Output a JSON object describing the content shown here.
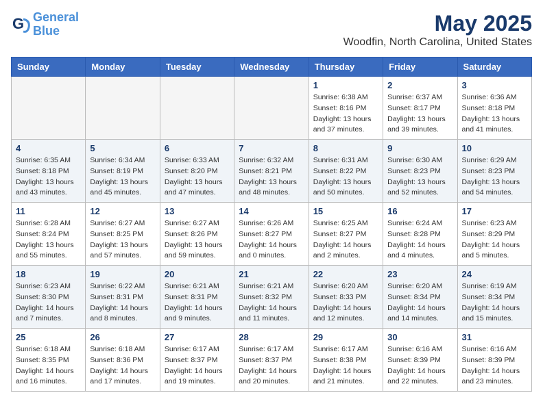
{
  "header": {
    "logo_line1": "General",
    "logo_line2": "Blue",
    "month": "May 2025",
    "location": "Woodfin, North Carolina, United States"
  },
  "days_of_week": [
    "Sunday",
    "Monday",
    "Tuesday",
    "Wednesday",
    "Thursday",
    "Friday",
    "Saturday"
  ],
  "weeks": [
    [
      {
        "num": "",
        "info": ""
      },
      {
        "num": "",
        "info": ""
      },
      {
        "num": "",
        "info": ""
      },
      {
        "num": "",
        "info": ""
      },
      {
        "num": "1",
        "info": "Sunrise: 6:38 AM\nSunset: 8:16 PM\nDaylight: 13 hours\nand 37 minutes."
      },
      {
        "num": "2",
        "info": "Sunrise: 6:37 AM\nSunset: 8:17 PM\nDaylight: 13 hours\nand 39 minutes."
      },
      {
        "num": "3",
        "info": "Sunrise: 6:36 AM\nSunset: 8:18 PM\nDaylight: 13 hours\nand 41 minutes."
      }
    ],
    [
      {
        "num": "4",
        "info": "Sunrise: 6:35 AM\nSunset: 8:18 PM\nDaylight: 13 hours\nand 43 minutes."
      },
      {
        "num": "5",
        "info": "Sunrise: 6:34 AM\nSunset: 8:19 PM\nDaylight: 13 hours\nand 45 minutes."
      },
      {
        "num": "6",
        "info": "Sunrise: 6:33 AM\nSunset: 8:20 PM\nDaylight: 13 hours\nand 47 minutes."
      },
      {
        "num": "7",
        "info": "Sunrise: 6:32 AM\nSunset: 8:21 PM\nDaylight: 13 hours\nand 48 minutes."
      },
      {
        "num": "8",
        "info": "Sunrise: 6:31 AM\nSunset: 8:22 PM\nDaylight: 13 hours\nand 50 minutes."
      },
      {
        "num": "9",
        "info": "Sunrise: 6:30 AM\nSunset: 8:23 PM\nDaylight: 13 hours\nand 52 minutes."
      },
      {
        "num": "10",
        "info": "Sunrise: 6:29 AM\nSunset: 8:23 PM\nDaylight: 13 hours\nand 54 minutes."
      }
    ],
    [
      {
        "num": "11",
        "info": "Sunrise: 6:28 AM\nSunset: 8:24 PM\nDaylight: 13 hours\nand 55 minutes."
      },
      {
        "num": "12",
        "info": "Sunrise: 6:27 AM\nSunset: 8:25 PM\nDaylight: 13 hours\nand 57 minutes."
      },
      {
        "num": "13",
        "info": "Sunrise: 6:27 AM\nSunset: 8:26 PM\nDaylight: 13 hours\nand 59 minutes."
      },
      {
        "num": "14",
        "info": "Sunrise: 6:26 AM\nSunset: 8:27 PM\nDaylight: 14 hours\nand 0 minutes."
      },
      {
        "num": "15",
        "info": "Sunrise: 6:25 AM\nSunset: 8:27 PM\nDaylight: 14 hours\nand 2 minutes."
      },
      {
        "num": "16",
        "info": "Sunrise: 6:24 AM\nSunset: 8:28 PM\nDaylight: 14 hours\nand 4 minutes."
      },
      {
        "num": "17",
        "info": "Sunrise: 6:23 AM\nSunset: 8:29 PM\nDaylight: 14 hours\nand 5 minutes."
      }
    ],
    [
      {
        "num": "18",
        "info": "Sunrise: 6:23 AM\nSunset: 8:30 PM\nDaylight: 14 hours\nand 7 minutes."
      },
      {
        "num": "19",
        "info": "Sunrise: 6:22 AM\nSunset: 8:31 PM\nDaylight: 14 hours\nand 8 minutes."
      },
      {
        "num": "20",
        "info": "Sunrise: 6:21 AM\nSunset: 8:31 PM\nDaylight: 14 hours\nand 9 minutes."
      },
      {
        "num": "21",
        "info": "Sunrise: 6:21 AM\nSunset: 8:32 PM\nDaylight: 14 hours\nand 11 minutes."
      },
      {
        "num": "22",
        "info": "Sunrise: 6:20 AM\nSunset: 8:33 PM\nDaylight: 14 hours\nand 12 minutes."
      },
      {
        "num": "23",
        "info": "Sunrise: 6:20 AM\nSunset: 8:34 PM\nDaylight: 14 hours\nand 14 minutes."
      },
      {
        "num": "24",
        "info": "Sunrise: 6:19 AM\nSunset: 8:34 PM\nDaylight: 14 hours\nand 15 minutes."
      }
    ],
    [
      {
        "num": "25",
        "info": "Sunrise: 6:18 AM\nSunset: 8:35 PM\nDaylight: 14 hours\nand 16 minutes."
      },
      {
        "num": "26",
        "info": "Sunrise: 6:18 AM\nSunset: 8:36 PM\nDaylight: 14 hours\nand 17 minutes."
      },
      {
        "num": "27",
        "info": "Sunrise: 6:17 AM\nSunset: 8:37 PM\nDaylight: 14 hours\nand 19 minutes."
      },
      {
        "num": "28",
        "info": "Sunrise: 6:17 AM\nSunset: 8:37 PM\nDaylight: 14 hours\nand 20 minutes."
      },
      {
        "num": "29",
        "info": "Sunrise: 6:17 AM\nSunset: 8:38 PM\nDaylight: 14 hours\nand 21 minutes."
      },
      {
        "num": "30",
        "info": "Sunrise: 6:16 AM\nSunset: 8:39 PM\nDaylight: 14 hours\nand 22 minutes."
      },
      {
        "num": "31",
        "info": "Sunrise: 6:16 AM\nSunset: 8:39 PM\nDaylight: 14 hours\nand 23 minutes."
      }
    ]
  ]
}
